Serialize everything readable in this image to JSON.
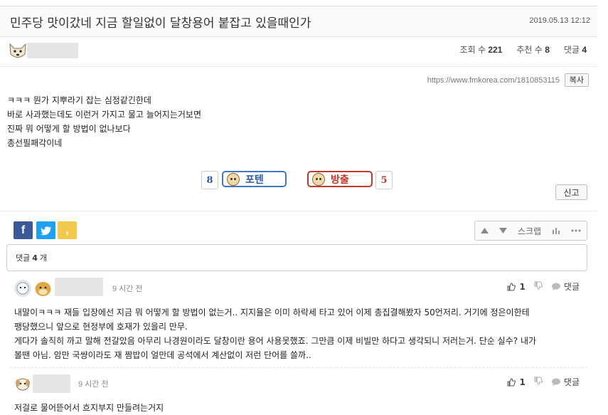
{
  "post": {
    "title": "민주당 맛이갔네 지금 할일없이 달창용어 붙잡고 있을때인가",
    "date": "2019.05.13 12:12",
    "meta": {
      "views_label": "조회 수",
      "views": "221",
      "recommend_label": "추천 수",
      "recommend": "8",
      "comments_label": "댓글",
      "comments": "4"
    },
    "url": "https://www.fmkorea.com/1810853115",
    "copy_label": "복사",
    "body": [
      "ㅋㅋㅋ 뭔가 지뿌라기 잡는 심정같긴한데",
      "바로 사과했는데도 이런거 가지고 물고 늘어지는거보면",
      "진짜 뭐 어떻게 할 방법이 없나보다",
      "총선필패각이네"
    ]
  },
  "votes": {
    "up_count": "8",
    "up_label": "포텐",
    "down_label": "방출",
    "down_count": "5",
    "report_label": "신고"
  },
  "share": {
    "facebook_glyph": "f",
    "kakao_glyph": ","
  },
  "scrap": {
    "label": "스크랩"
  },
  "comment_box": {
    "prefix": "댓글",
    "count": "4",
    "suffix": "개"
  },
  "comments": [
    {
      "time": "9 시간 전",
      "likes": "1",
      "reply_label": "댓글",
      "lines": [
        "내말이ㅋㅋㅋ 재들 입장에선 지금 뭐 어떻게 할 방법이 없는거.. 지지율은 이미 하락세 타고 있어 이제 총집결해봤자 50언저리. 거기에 정은이한테",
        "팽당했으니 앞으로 현정부에 호재가 있을리 만무.",
        "게다가 솔직히 까고 말해 전갈았음 아무리 나경원이라도 달창이란 용어 사용못했죠. 그만큼 이제 비빌만 하다고 생각되니 저러는거. 단순 실수? 내가",
        "볼땐 아님. 암만 국썅이라도 재 짬밥이 얼만데 공석에서 계산없이 저런 단어를 쓸까.."
      ]
    },
    {
      "time": "9 시간 전",
      "likes": "1",
      "reply_label": "댓글",
      "lines": [
        "저걸로 물어뜯어서 흐지부지 만들려는거지"
      ]
    }
  ],
  "colors": {
    "up_accent": "#3f78c0",
    "down_accent": "#c0392b",
    "facebook": "#3b5998",
    "twitter": "#1da1f2",
    "kakao": "#f2c94c"
  }
}
